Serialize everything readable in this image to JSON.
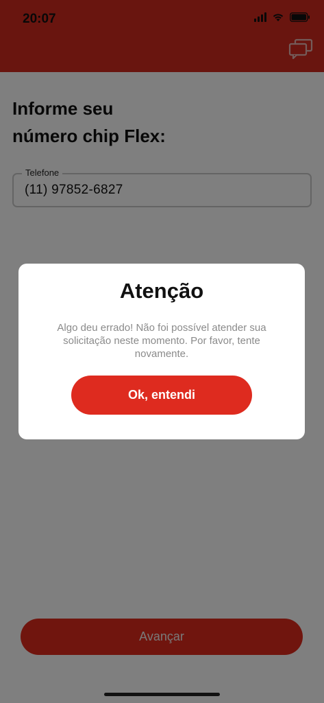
{
  "status_bar": {
    "time": "20:07"
  },
  "header": {
    "chat_icon": "chat-bubbles-icon"
  },
  "page": {
    "title_line1": "Informe seu",
    "title_line2": "número chip Flex:"
  },
  "phone_field": {
    "label": "Telefone",
    "value": "(11) 97852-6827"
  },
  "footer": {
    "next_label": "Avançar"
  },
  "dialog": {
    "title": "Atenção",
    "message": "Algo deu errado! Não foi possível atender sua solicitação neste momento. Por favor, tente novamente.",
    "ok_label": "Ok, entendi"
  },
  "colors": {
    "brand_red": "#d32b1f",
    "button_red": "#de2b1f",
    "overlay": "rgba(0,0,0,0.5)"
  }
}
